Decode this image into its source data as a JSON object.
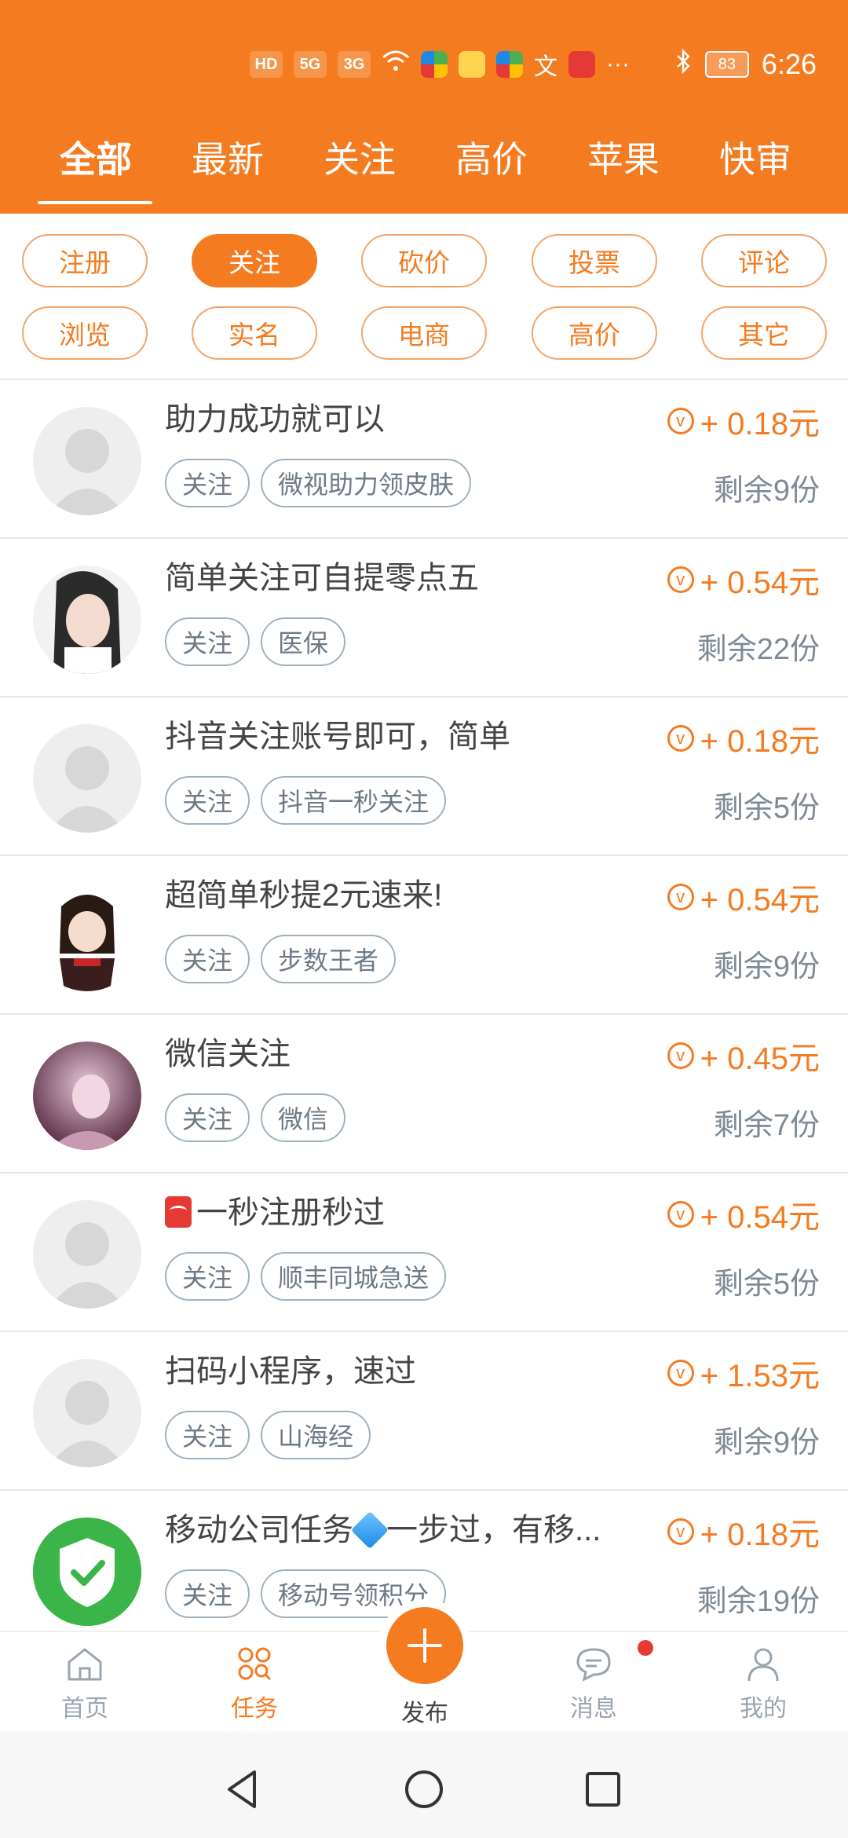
{
  "status_bar": {
    "time": "6:26",
    "battery": "83",
    "network": "5G"
  },
  "tabs": [
    "全部",
    "最新",
    "关注",
    "高价",
    "苹果",
    "快审"
  ],
  "filters_row1": [
    "注册",
    "关注",
    "砍价",
    "投票",
    "评论"
  ],
  "filters_row2": [
    "浏览",
    "实名",
    "电商",
    "高价",
    "其它"
  ],
  "active_filter": "关注",
  "tasks": [
    {
      "title": "助力成功就可以",
      "tags": [
        "关注",
        "微视助力领皮肤"
      ],
      "reward": "+ 0.18元",
      "remain": "剩余9份",
      "avatar": "default"
    },
    {
      "title": "简单关注可自提零点五",
      "tags": [
        "关注",
        "医保"
      ],
      "reward": "+ 0.54元",
      "remain": "剩余22份",
      "avatar": "photo-girl"
    },
    {
      "title": "抖音关注账号即可，简单",
      "tags": [
        "关注",
        "抖音一秒关注"
      ],
      "reward": "+ 0.18元",
      "remain": "剩余5份",
      "avatar": "default"
    },
    {
      "title": "超简单秒提2元速来!",
      "tags": [
        "关注",
        "步数王者"
      ],
      "reward": "+ 0.54元",
      "remain": "剩余9份",
      "avatar": "anime"
    },
    {
      "title": "微信关注",
      "tags": [
        "关注",
        "微信"
      ],
      "reward": "+ 0.45元",
      "remain": "剩余7份",
      "avatar": "photo-pink"
    },
    {
      "title": "一秒注册秒过",
      "tags": [
        "关注",
        "顺丰同城急送"
      ],
      "reward": "+ 0.54元",
      "remain": "剩余5份",
      "avatar": "default"
    },
    {
      "title": "扫码小程序，速过",
      "tags": [
        "关注",
        "山海经"
      ],
      "reward": "+ 1.53元",
      "remain": "剩余9份",
      "avatar": "default"
    },
    {
      "title_a": "移动公司任务",
      "title_b": "一步过，有移...",
      "tags": [
        "关注",
        "移动号领积分"
      ],
      "reward": "+ 0.18元",
      "remain": "剩余19份",
      "avatar": "shield"
    }
  ],
  "bottom_nav": {
    "home": "首页",
    "tasks": "任务",
    "publish": "发布",
    "messages": "消息",
    "me": "我的"
  },
  "colors": {
    "accent": "#F47B20",
    "muted_text": "#7E8A95"
  }
}
